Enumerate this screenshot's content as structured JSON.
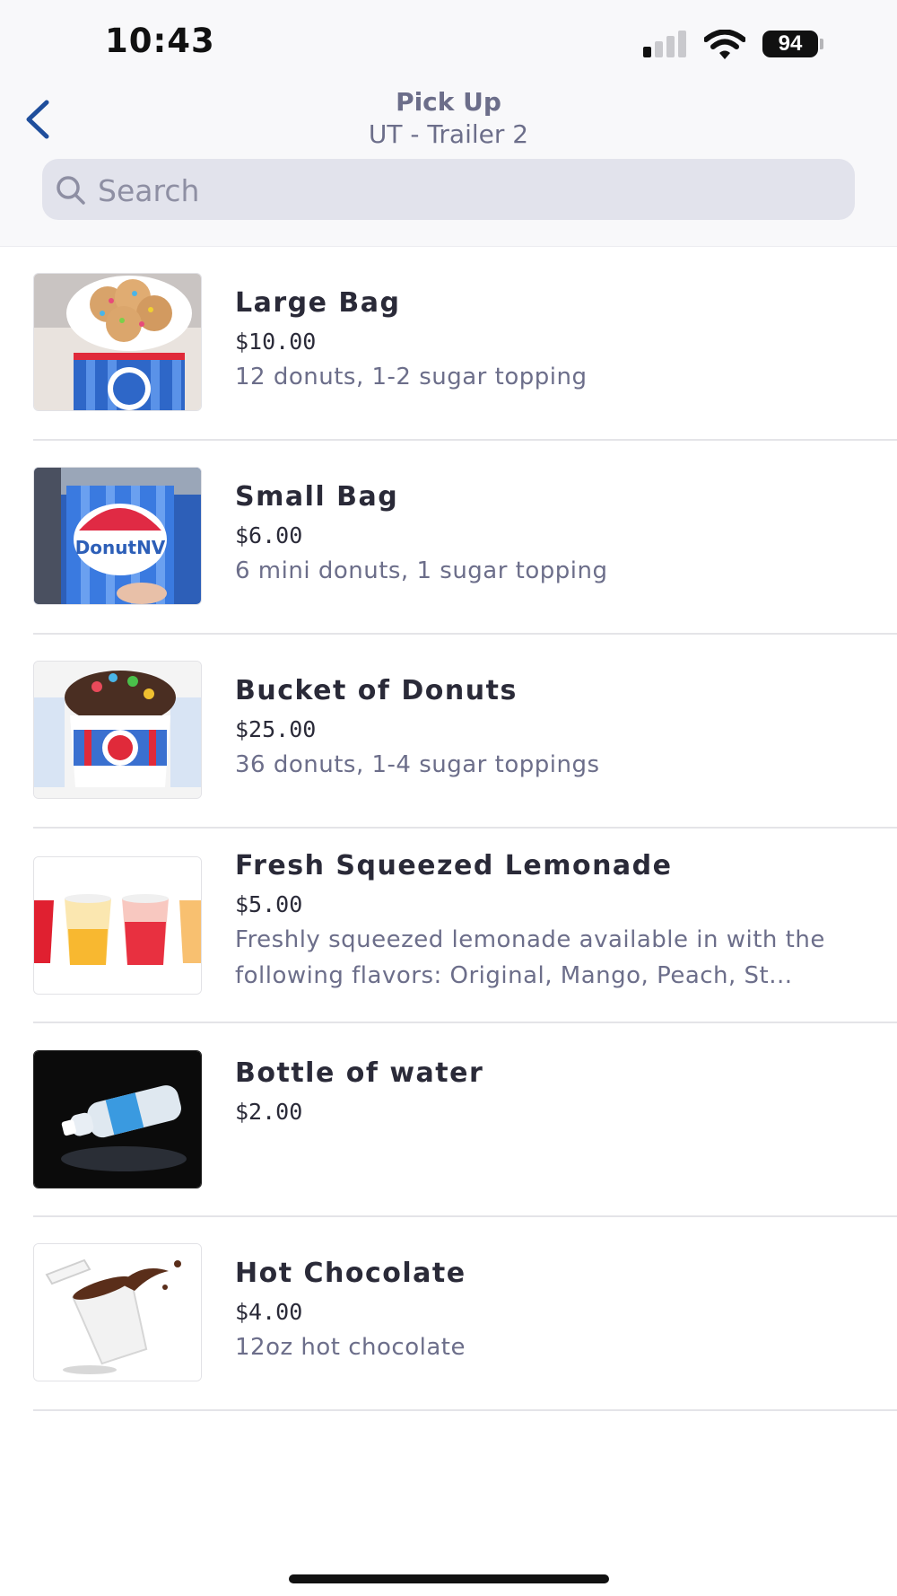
{
  "status_bar": {
    "time": "10:43",
    "battery": "94"
  },
  "header": {
    "title": "Pick Up",
    "subtitle": "UT - Trailer 2",
    "back_icon": "chevron-left-icon"
  },
  "search": {
    "placeholder": "Search",
    "value": ""
  },
  "colors": {
    "accent": "#1f4e9c",
    "header_text": "#6c6e8a",
    "search_bg": "#e2e3ec"
  },
  "menu": {
    "items": [
      {
        "name": "Large Bag",
        "price": "$10.00",
        "description": "12 donuts, 1-2 sugar topping",
        "image": "donuts-bag-photo"
      },
      {
        "name": "Small Bag",
        "price": "$6.00",
        "description": "6 mini donuts, 1 sugar topping",
        "image": "donut-nv-bag-photo"
      },
      {
        "name": "Bucket of Donuts",
        "price": "$25.00",
        "description": "36 donuts, 1-4 sugar toppings",
        "image": "donut-bucket-photo"
      },
      {
        "name": "Fresh Squeezed Lemonade",
        "price": "$5.00",
        "description": "Freshly squeezed lemonade available in with the following flavors: Original, Mango, Peach, St...",
        "image": "lemonade-cups-photo"
      },
      {
        "name": "Bottle of water",
        "price": "$2.00",
        "description": "",
        "image": "water-bottle-photo"
      },
      {
        "name": "Hot Chocolate",
        "price": "$4.00",
        "description": "12oz hot chocolate",
        "image": "hot-chocolate-cup-photo"
      }
    ]
  }
}
